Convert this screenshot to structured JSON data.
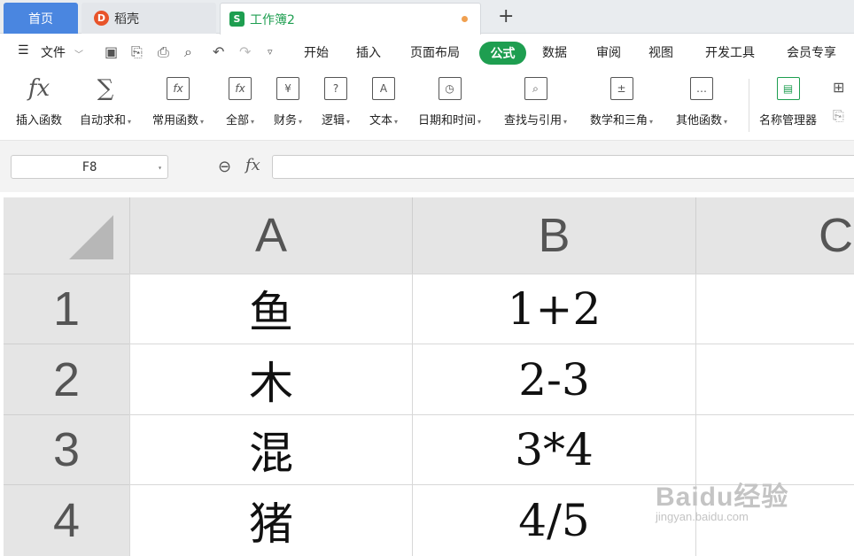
{
  "tabs": {
    "home": "首页",
    "docer": "稻壳",
    "workbook": "工作簿2",
    "new_tab": "+"
  },
  "menu": {
    "file": "文件",
    "items": [
      "开始",
      "插入",
      "页面布局",
      "公式",
      "数据",
      "审阅",
      "视图",
      "开发工具",
      "会员专享"
    ],
    "active": "公式"
  },
  "ribbon": {
    "buttons": [
      {
        "label": "插入函数",
        "icon": "fx-icon",
        "glyph": "fx",
        "dropdown": false
      },
      {
        "label": "自动求和",
        "icon": "sigma-icon",
        "glyph": "∑",
        "dropdown": true
      },
      {
        "label": "常用函数",
        "icon": "common-functions-icon",
        "glyph": "fx",
        "dropdown": true
      },
      {
        "label": "全部",
        "icon": "all-functions-icon",
        "glyph": "fx",
        "dropdown": true
      },
      {
        "label": "财务",
        "icon": "finance-icon",
        "glyph": "¥",
        "dropdown": true
      },
      {
        "label": "逻辑",
        "icon": "logic-icon",
        "glyph": "?",
        "dropdown": true
      },
      {
        "label": "文本",
        "icon": "text-icon",
        "glyph": "A",
        "dropdown": true
      },
      {
        "label": "日期和时间",
        "icon": "datetime-icon",
        "glyph": "◷",
        "dropdown": true
      },
      {
        "label": "查找与引用",
        "icon": "lookup-icon",
        "glyph": "⌕",
        "dropdown": true
      },
      {
        "label": "数学和三角",
        "icon": "math-icon",
        "glyph": "±",
        "dropdown": true
      },
      {
        "label": "其他函数",
        "icon": "other-functions-icon",
        "glyph": "…",
        "dropdown": true
      },
      {
        "label": "名称管理器",
        "icon": "name-manager-icon",
        "glyph": "▤",
        "dropdown": false
      }
    ]
  },
  "formula_bar": {
    "name_box": "F8",
    "fx": "fx",
    "value": ""
  },
  "grid": {
    "columns": [
      "A",
      "B",
      "C"
    ],
    "rows": [
      {
        "num": "1",
        "a": "鱼",
        "b": "1+2"
      },
      {
        "num": "2",
        "a": "木",
        "b": "2-3"
      },
      {
        "num": "3",
        "a": "混",
        "b": "3*4"
      },
      {
        "num": "4",
        "a": "猪",
        "b": "4/5"
      }
    ]
  },
  "watermark": {
    "main": "Baidu经验",
    "sub": "jingyan.baidu.com"
  }
}
